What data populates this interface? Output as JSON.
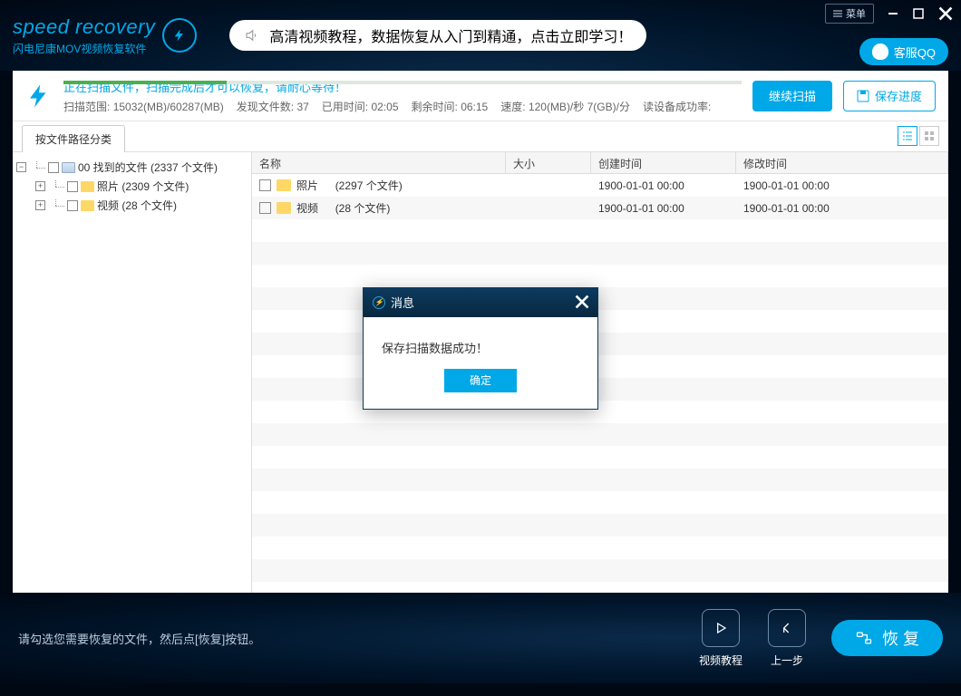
{
  "header": {
    "logo_main": "speed recovery",
    "logo_sub": "闪电尼康MOV视频恢复软件",
    "promo_text": "高清视频教程，数据恢复从入门到精通，点击立即学习！",
    "menu_label": "菜单",
    "qq_label": "客服QQ"
  },
  "scan": {
    "message": "正在扫描文件，扫描完成后才可以恢复，请耐心等待！",
    "range_label": "扫描范围:",
    "range_value": "15032(MB)/60287(MB)",
    "found_label": "发现文件数:",
    "found_value": "37",
    "elapsed_label": "已用时间:",
    "elapsed_value": "02:05",
    "remain_label": "剩余时间:",
    "remain_value": "06:15",
    "speed_label": "速度:",
    "speed_value": "120(MB)/秒  7(GB)/分",
    "success_label": "读设备成功率:",
    "continue_btn": "继续扫描",
    "save_progress_btn": "保存进度"
  },
  "tabs": {
    "by_path": "按文件路径分类"
  },
  "tree": {
    "root": "00 找到的文件   (2337 个文件)",
    "photos": "照片     (2309 个文件)",
    "videos": "视频     (28 个文件)"
  },
  "table": {
    "headers": {
      "name": "名称",
      "size": "大小",
      "created": "创建时间",
      "modified": "修改时间"
    },
    "rows": [
      {
        "name": "照片",
        "count": "(2297 个文件)",
        "created": "1900-01-01  00:00",
        "modified": "1900-01-01  00:00"
      },
      {
        "name": "视频",
        "count": "(28 个文件)",
        "created": "1900-01-01  00:00",
        "modified": "1900-01-01  00:00"
      }
    ]
  },
  "modal": {
    "title": "消息",
    "body": "保存扫描数据成功！",
    "ok": "确定"
  },
  "footer": {
    "hint": "请勾选您需要恢复的文件，然后点[恢复]按钮。",
    "tutorial": "视频教程",
    "back": "上一步",
    "recover": "恢 复"
  }
}
